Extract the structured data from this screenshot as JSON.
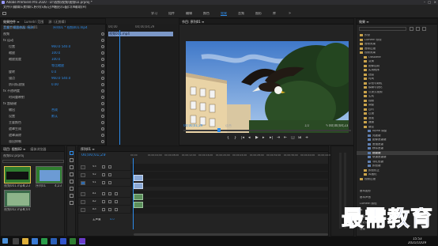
{
  "window": {
    "title": "Adobe Premiere Pro 2020 - D:\\视频\\视频\\视频02.prproj *"
  },
  "menu": [
    "文件(F)",
    "编辑(E)",
    "剪辑(C)",
    "序列(S)",
    "标记(M)",
    "图形(G)",
    "窗口(W)",
    "帮助(H)"
  ],
  "workspaces": [
    "学习",
    "组件",
    "编辑",
    "颜色",
    "效果",
    "音频",
    "图形",
    "库"
  ],
  "workspaces_active": 4,
  "effect_controls": {
    "tabs": [
      "效果控件 ≡",
      "Lumetri 范围",
      "源: (无剪辑)",
      "音频剪辑混合器: 序列01"
    ],
    "master": "主要 * 视频001.mp4",
    "seq": "序列01 * 视频001.mp4",
    "rows": [
      {
        "label": "视频",
        "value": ""
      },
      {
        "label": "fx 运动",
        "value": ""
      },
      {
        "label": "位置",
        "value": "960.0  540.0"
      },
      {
        "label": "缩放",
        "value": "100.0"
      },
      {
        "label": "缩放宽度",
        "value": "100.0"
      },
      {
        "label": "",
        "value": "等比缩放"
      },
      {
        "label": "旋转",
        "value": "0.0"
      },
      {
        "label": "锚点",
        "value": "960.0  540.0"
      },
      {
        "label": "防闪烁滤镜",
        "value": "0.00"
      },
      {
        "label": "fx 不透明度",
        "value": ""
      },
      {
        "label": "时间重映射",
        "value": ""
      },
      {
        "label": "fx 超级键",
        "value": ""
      },
      {
        "label": "输出",
        "value": "合成"
      },
      {
        "label": "设置",
        "value": "默认"
      },
      {
        "label": "主要颜色",
        "value": ""
      },
      {
        "label": "遮罩生成",
        "value": ""
      },
      {
        "label": "遮罩清除",
        "value": ""
      },
      {
        "label": "溢出抑制",
        "value": ""
      },
      {
        "label": "颜色校正",
        "value": ""
      }
    ],
    "timecode": "00;00;01;29"
  },
  "source_timeline": {
    "clip": "视频001.mp4",
    "ticks": [
      "00;00",
      "00;00;04;29"
    ]
  },
  "program": {
    "tab": "节目: 序列01 ≡",
    "timecode": "00;00;01;29",
    "fit": "适合",
    "fraction": "1/2",
    "duration": "00;00;04;23"
  },
  "project": {
    "tabs": [
      "项目: 视频02 ≡",
      "媒体浏览器"
    ],
    "name": "视频02.prproj",
    "items": [
      {
        "name": "视频001.mp4",
        "dur": "4;23"
      },
      {
        "name": "序列01",
        "dur": "4;23"
      },
      {
        "name": "视频002.mp4",
        "dur": "4;04"
      }
    ]
  },
  "timeline": {
    "tab": "序列01 ≡",
    "timecode": "00;00;01;29",
    "ruler": [
      "00;00",
      "00;00;04;00",
      "00;00;08;00",
      "00;00;12;00",
      "00;00;16;00",
      "00;00;20;00",
      "00;00;24;00",
      "00;00;28;00",
      "00;00;32;00",
      "00;00;36;00",
      "00;00;40;00",
      "00;00;44;00"
    ],
    "tracks": [
      "V3",
      "V2",
      "V1",
      "A1",
      "A2",
      "A3"
    ],
    "master": "主声道",
    "master_val": "0.0"
  },
  "effects": {
    "tab": "效果 ≡",
    "items": [
      "预设",
      "Lumetri 预设",
      "音频效果",
      "音频过渡",
      "视频效果",
      "Obsolete",
      "变换",
      "图像控制",
      "实用程序",
      "扭曲",
      "时间",
      "杂色与颗粒",
      "模糊与锐化",
      "沉浸式视频",
      "生成",
      "视频",
      "调整",
      "过时",
      "过渡",
      "透视",
      "通道",
      "键控",
      "Alpha 调整",
      "亮度键",
      "图像遮罩键",
      "差值遮罩",
      "移除遮罩",
      "超级键",
      "轨道遮罩键",
      "非红色键",
      "颜色键",
      "颜色校正",
      "风格化",
      "视频过渡"
    ],
    "selected": "超级键",
    "bottom": [
      "基本图形",
      "基本声音",
      "Lumetri 颜色",
      "库",
      "标记",
      "历史记录",
      "信息"
    ]
  },
  "watermark": "最需教育",
  "clock": {
    "time": "15:53",
    "date": "2021/10/29"
  },
  "colors": {
    "accent": "#2d8ceb",
    "playhead": "#2d8ceb",
    "bg": "#232323"
  }
}
